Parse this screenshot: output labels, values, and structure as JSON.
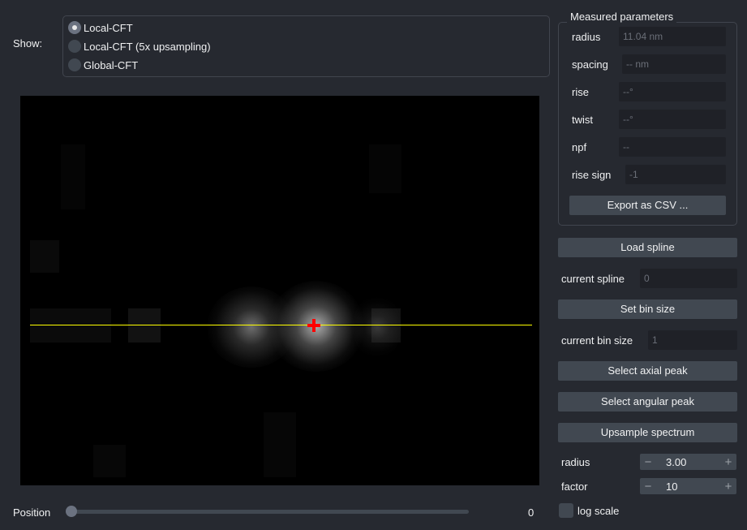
{
  "show": {
    "label": "Show:",
    "options": [
      {
        "label": "Local-CFT",
        "checked": true
      },
      {
        "label": "Local-CFT (5x upsampling)",
        "checked": false
      },
      {
        "label": "Global-CFT",
        "checked": false
      }
    ]
  },
  "canvas": {
    "line_color": "#ffff00",
    "marker_color": "#ff0000"
  },
  "position": {
    "label": "Position",
    "value": "0",
    "slider_fraction": 0
  },
  "measured": {
    "title": "Measured parameters",
    "fields": [
      {
        "label": "radius",
        "value": "11.04 nm"
      },
      {
        "label": "spacing",
        "value": "-- nm"
      },
      {
        "label": "rise",
        "value": "--°"
      },
      {
        "label": "twist",
        "value": "--°"
      },
      {
        "label": "npf",
        "value": "--"
      },
      {
        "label": "rise sign",
        "value": "-1"
      }
    ],
    "export_label": "Export as CSV ..."
  },
  "controls": {
    "load_spline": "Load spline",
    "current_spline_label": "current spline",
    "current_spline_value": "0",
    "set_bin_size": "Set bin size",
    "current_bin_size_label": "current bin size",
    "current_bin_size_value": "1",
    "select_axial_peak": "Select axial peak",
    "select_angular_peak": "Select angular peak",
    "upsample_spectrum": "Upsample spectrum",
    "radius_label": "radius",
    "radius_value": "3.00",
    "factor_label": "factor",
    "factor_value": "10",
    "minus_glyph": "−",
    "plus_glyph": "+",
    "log_scale_label": "log scale",
    "log_scale_checked": false
  }
}
